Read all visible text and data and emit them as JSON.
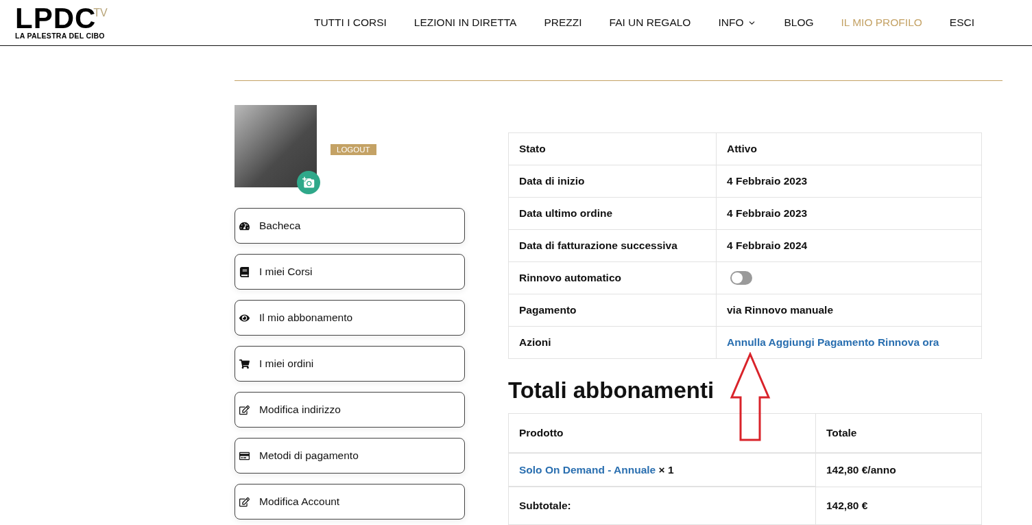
{
  "logo": {
    "main": "LPDC",
    "suffix": "TV",
    "tagline": "LA PALESTRA DEL CIBO"
  },
  "nav": [
    {
      "label": "TUTTI I CORSI",
      "selected": false,
      "dropdown": false
    },
    {
      "label": "LEZIONI IN DIRETTA",
      "selected": false,
      "dropdown": false
    },
    {
      "label": "PREZZI",
      "selected": false,
      "dropdown": false
    },
    {
      "label": "FAI UN REGALO",
      "selected": false,
      "dropdown": false
    },
    {
      "label": "INFO",
      "selected": false,
      "dropdown": true
    },
    {
      "label": "BLOG",
      "selected": false,
      "dropdown": false
    },
    {
      "label": "IL MIO PROFILO",
      "selected": true,
      "dropdown": false
    },
    {
      "label": "ESCI",
      "selected": false,
      "dropdown": false
    }
  ],
  "profile": {
    "logout": "LOGOUT"
  },
  "sidebar": {
    "items": [
      {
        "kind": "dashboard",
        "label": "Bacheca"
      },
      {
        "kind": "courses",
        "label": "I miei Corsi"
      },
      {
        "kind": "subscription",
        "label": "Il mio abbonamento"
      },
      {
        "kind": "orders",
        "label": "I miei ordini"
      },
      {
        "kind": "address",
        "label": "Modifica indirizzo"
      },
      {
        "kind": "payment",
        "label": "Metodi di pagamento"
      },
      {
        "kind": "account",
        "label": "Modifica Account"
      }
    ]
  },
  "subscription": {
    "rows": [
      {
        "kind": "text",
        "label": "Stato",
        "value": "Attivo"
      },
      {
        "kind": "text",
        "label": "Data di inizio",
        "value": "4 Febbraio 2023"
      },
      {
        "kind": "text",
        "label": "Data ultimo ordine",
        "value": "4 Febbraio 2023"
      },
      {
        "kind": "text",
        "label": "Data di fatturazione successiva",
        "value": "4 Febbraio 2024"
      },
      {
        "kind": "toggle",
        "label": "Rinnovo automatico",
        "on": false
      },
      {
        "kind": "text",
        "label": "Pagamento",
        "value": "via Rinnovo manuale"
      },
      {
        "kind": "links",
        "label": "Azioni",
        "links": [
          "Annulla",
          "Aggiungi Pagamento",
          "Rinnova ora"
        ]
      }
    ]
  },
  "totals": {
    "title": "Totali abbonamenti",
    "columns": [
      "Prodotto",
      "Totale"
    ],
    "rows": [
      {
        "kind": "product",
        "product": "Solo On Demand - Annuale",
        "quantity": "× 1",
        "total": "142,80 €/anno"
      },
      {
        "kind": "text",
        "product": "Subtotale:",
        "total": "142,80 €"
      }
    ]
  }
}
